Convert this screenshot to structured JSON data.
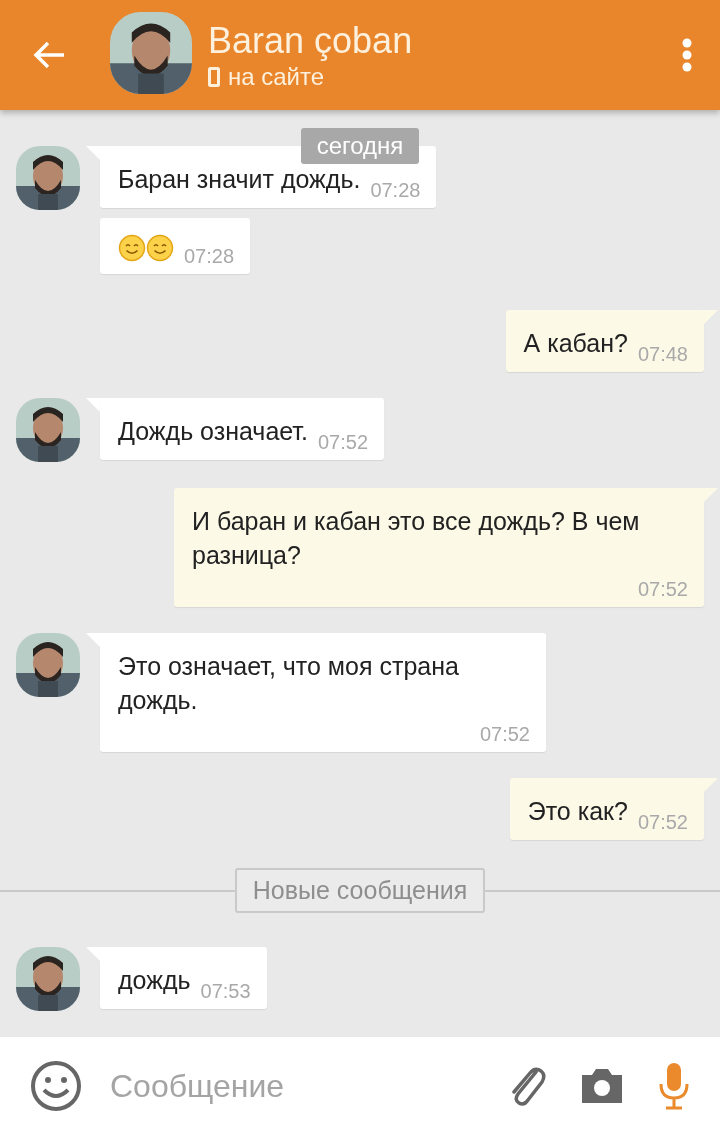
{
  "header": {
    "name": "Baran çoban",
    "status": "на сайте"
  },
  "items": [
    {
      "kind": "date",
      "text": "сегодня"
    },
    {
      "kind": "message",
      "outgoing": false,
      "avatar": true,
      "text": "Баран значит дождь.",
      "time": "07:28"
    },
    {
      "kind": "emoji",
      "outgoing": false,
      "avatar": false,
      "emojis": [
        {
          "kind": "smile"
        },
        {
          "kind": "smile"
        }
      ],
      "time": "07:28"
    },
    {
      "kind": "message",
      "outgoing": true,
      "text": "А кабан?",
      "time": "07:48"
    },
    {
      "kind": "message",
      "outgoing": false,
      "avatar": true,
      "text": "Дождь означает.",
      "time": "07:52"
    },
    {
      "kind": "message",
      "outgoing": true,
      "text": "И баран и кабан это все дождь? В чем разница?",
      "time": "07:52"
    },
    {
      "kind": "message",
      "outgoing": false,
      "avatar": true,
      "text": "Это означает, что моя страна дождь.",
      "time": "07:52"
    },
    {
      "kind": "message",
      "outgoing": true,
      "text": "Это как?",
      "time": "07:52"
    },
    {
      "kind": "divider",
      "text": "Новые сообщения"
    },
    {
      "kind": "message",
      "outgoing": false,
      "avatar": true,
      "text": "дождь",
      "time": "07:53"
    }
  ],
  "composer": {
    "placeholder": "Сообщение"
  }
}
